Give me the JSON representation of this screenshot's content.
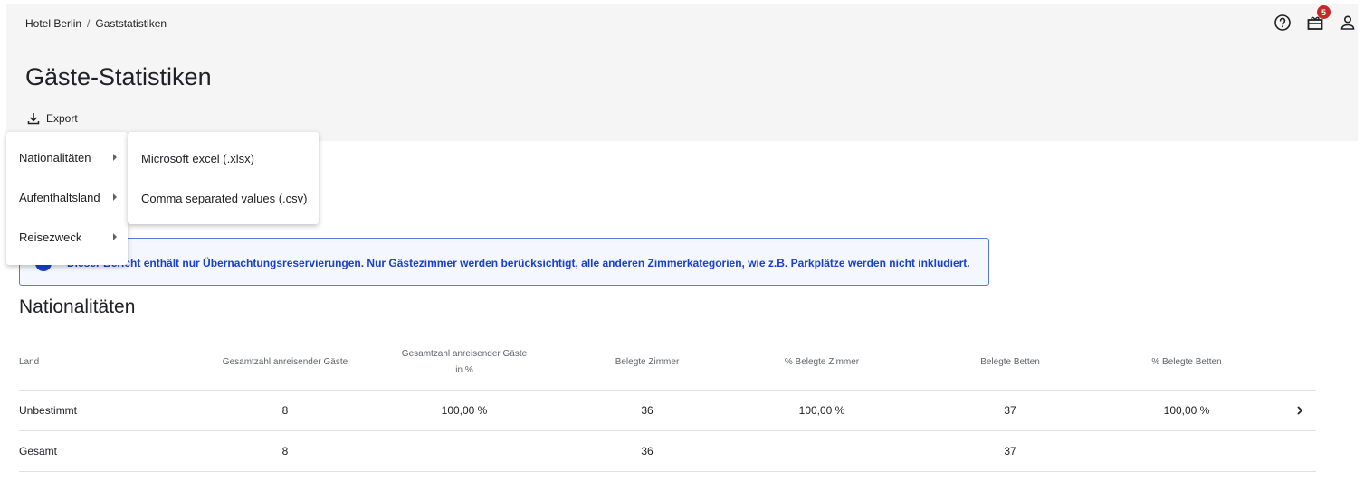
{
  "breadcrumb": {
    "hotel": "Hotel Berlin",
    "separator": "/",
    "page": "Gaststatistiken"
  },
  "header": {
    "notification_count": "5"
  },
  "page_title": "Gäste-Statistiken",
  "export": {
    "label": "Export"
  },
  "export_menu": {
    "items": [
      {
        "label": "Nationalitäten"
      },
      {
        "label": "Aufenthaltsland"
      },
      {
        "label": "Reisezweck"
      }
    ],
    "submenu": [
      {
        "label": "Microsoft excel (.xlsx)"
      },
      {
        "label": "Comma separated values (.csv)"
      }
    ]
  },
  "info": {
    "text": "Dieser Bericht enthält nur Übernachtungsreservierungen. Nur Gästezimmer werden berücksichtigt, alle anderen Zimmerkategorien, wie z.B. Parkplätze werden nicht inkludiert."
  },
  "section_title": "Nationalitäten",
  "table": {
    "headers": {
      "land": "Land",
      "total_guests": "Gesamtzahl anreisender Gäste",
      "total_guests_pct": "Gesamtzahl anreisender Gäste in %",
      "rooms": "Belegte Zimmer",
      "rooms_pct": "% Belegte Zimmer",
      "beds": "Belegte Betten",
      "beds_pct": "% Belegte Betten"
    },
    "rows": [
      {
        "land": "Unbestimmt",
        "total_guests": "8",
        "total_guests_pct": "100,00 %",
        "rooms": "36",
        "rooms_pct": "100,00 %",
        "beds": "37",
        "beds_pct": "100,00 %"
      },
      {
        "land": "Gesamt",
        "total_guests": "8",
        "total_guests_pct": "",
        "rooms": "36",
        "rooms_pct": "",
        "beds": "37",
        "beds_pct": ""
      }
    ]
  },
  "colors": {
    "accent": "#1a3fc9",
    "badge": "#c62828",
    "header_bg": "#f5f5f5"
  }
}
